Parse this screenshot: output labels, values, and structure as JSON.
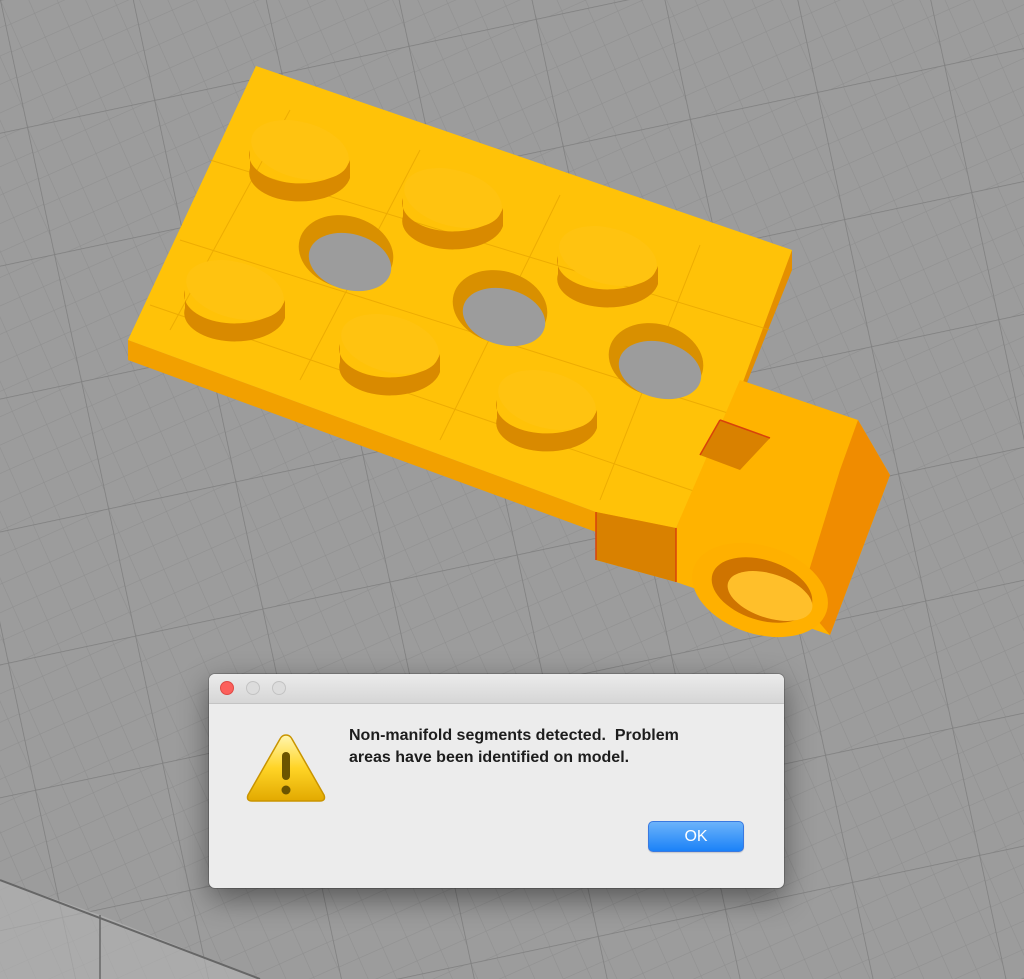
{
  "viewport": {
    "background_color": "#9c9c9c",
    "grid_color": "#8b8b8b",
    "model_colors": {
      "top": "#ffc106",
      "front": "#f7a800",
      "side": "#e08a00",
      "shadow": "#c76e00",
      "highlight": "#d84a0a"
    }
  },
  "dialog": {
    "title": "",
    "icon": "warning-triangle-icon",
    "message_line1": "Non-manifold segments detected.  Problem",
    "message_line2": "areas have been identified on model.",
    "ok_label": "OK",
    "accent_color": "#1b82f8",
    "window_buttons": [
      "close-window-icon",
      "minimize-window-icon",
      "zoom-window-icon"
    ]
  }
}
